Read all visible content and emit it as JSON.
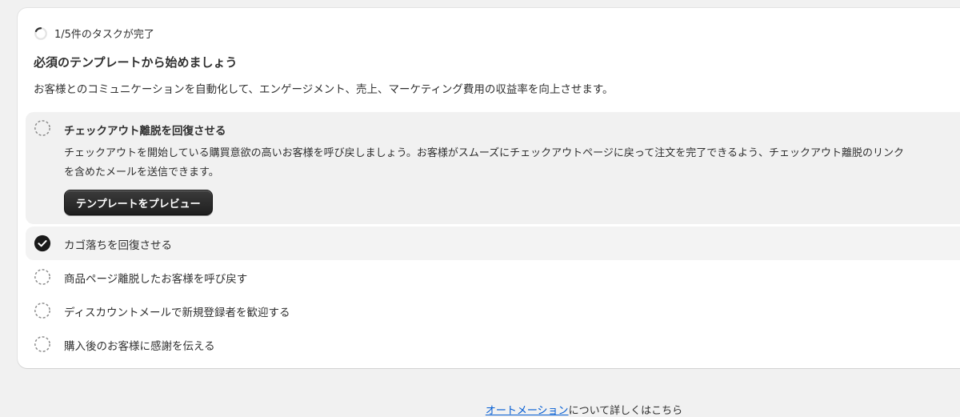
{
  "progress": {
    "text": "1/5件のタスクが完了",
    "completed": 1,
    "total": 5
  },
  "card": {
    "title": "必須のテンプレートから始めましょう",
    "description": "お客様とのコミュニケーションを自動化して、エンゲージメント、売上、マーケティング費用の収益率を向上させます。"
  },
  "tasks": [
    {
      "label": "チェックアウト離脱を回復させる",
      "description": "チェックアウトを開始している購買意欲の高いお客様を呼び戻しましょう。お客様がスムーズにチェックアウトページに戻って注文を完了できるよう、チェックアウト離脱のリンクを含めたメールを送信できます。",
      "button": "テンプレートをプレビュー",
      "completed": false
    },
    {
      "label": "カゴ落ちを回復させる",
      "completed": true
    },
    {
      "label": "商品ページ離脱したお客様を呼び戻す",
      "completed": false
    },
    {
      "label": "ディスカウントメールで新規登録者を歓迎する",
      "completed": false
    },
    {
      "label": "購入後のお客様に感謝を伝える",
      "completed": false
    }
  ],
  "footer": {
    "link": "オートメーション",
    "text": "について詳しくはこちら"
  },
  "colors": {
    "link": "#005bd3",
    "check": "#1a1a1a",
    "button": "#2a2a2a"
  }
}
